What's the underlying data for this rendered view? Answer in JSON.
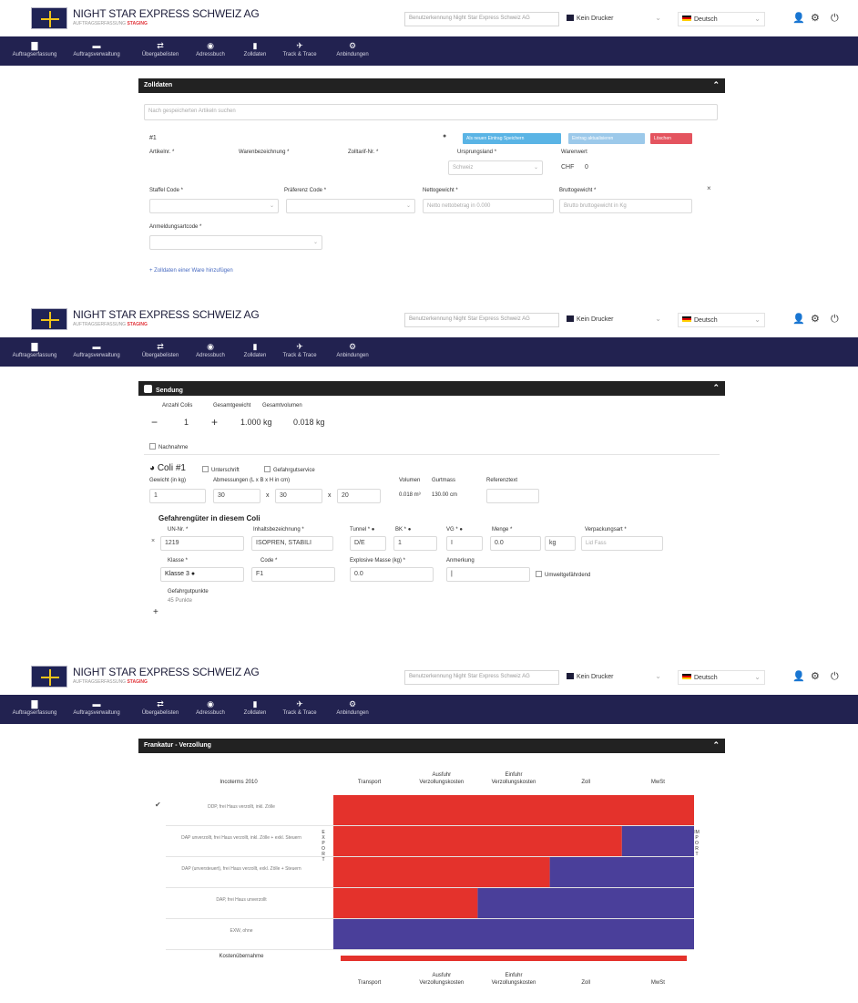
{
  "header": {
    "brand": "NIGHT STAR EXPRESS SCHWEIZ AG",
    "sub_prefix": "AUFTRAGSERFASSUNG",
    "sub_env": "STAGING",
    "user_select": "Benutzerkennung Night Star Express Schweiz AG",
    "printer": "Kein Drucker",
    "language": "Deutsch"
  },
  "nav": [
    {
      "label": "Auftragserfassung",
      "icon": "file-icon"
    },
    {
      "label": "Auftragsverwaltung",
      "icon": "folder-icon"
    },
    {
      "label": "Übergabelisten",
      "icon": "exchange-icon"
    },
    {
      "label": "Adressbuch",
      "icon": "address-book-icon"
    },
    {
      "label": "Zolldaten",
      "icon": "document-icon"
    },
    {
      "label": "Track & Trace",
      "icon": "track-icon"
    },
    {
      "label": "Anbindungen",
      "icon": "cogs-icon"
    }
  ],
  "zolldaten": {
    "title": "Zolldaten",
    "search_placeholder": "Nach gespeicherten Artikeln suchen",
    "position": "#1",
    "btn_save_catalog": "Als neuen Eintrag Speichern",
    "btn_update_catalog": "Eintrag aktualisieren",
    "btn_delete": "Löschen",
    "label_article_no": "Artikelnr. *",
    "label_goods_description": "Warenbezeichnung *",
    "label_tariff_no": "Zolltarif-Nr. *",
    "label_origin_country": "Ursprungsland *",
    "origin_country_value": "Schweiz",
    "label_goods_value": "Warenwert",
    "goods_value_currency": "CHF",
    "goods_value_amount": "0",
    "label_treaty_code": "Staffel Code *",
    "label_preference_code": "Präferenz Code *",
    "label_net_weight": "Nettogewicht *",
    "net_weight_placeholder": "Netto nettobetrag in 0.000",
    "label_gross_weight": "Bruttogewicht *",
    "gross_weight_placeholder": "Brutto bruttogewicht in Kg",
    "label_declaration_code": "Anmeldungsartcode *",
    "add_link": "+ Zolldaten einer Ware hinzufügen"
  },
  "sendung": {
    "title": "Sendung",
    "label_count": "Anzahl Colis",
    "label_total_weight": "Gesamtgewicht",
    "label_total_volume": "Gesamtvolumen",
    "count_value": "1",
    "total_weight": "1.000 kg",
    "total_volume": "0.018 kg",
    "nachnahme": "Nachnahme",
    "coli_title": "Coli #1",
    "coli_check_unterschrift": "Unterschrift",
    "coli_check_gefahrgut": "Gefahrgutservice",
    "label_weight": "Gewicht (in kg)",
    "label_dimensions": "Abmessungen (L x B x H in cm)",
    "label_volume": "Volumen",
    "label_girth": "Gurtmass",
    "label_reference": "Referenztext",
    "weight_value": "1",
    "dim_l": "30",
    "dim_b": "30",
    "dim_h": "20",
    "times": "x",
    "volume_value": "0.018 m³",
    "girth_value": "130.00 cm",
    "dg_title": "Gefahrengüter in diesem Coli",
    "label_un": "UN-Nr. *",
    "label_inhalt": "Inhaltsbezeichnung *",
    "label_tunnel": "Tunnel *",
    "label_bk": "BK *",
    "label_vg": "VG *",
    "label_menge": "Menge *",
    "label_packaging": "Verpackungsart *",
    "un_value": "1219",
    "inhalt_value": "ISOPREN, STABILI",
    "tunnel_value": "D/E",
    "bk_value": "1",
    "vg_value": "I",
    "menge_value": "0.0",
    "unit_value": "kg",
    "packaging_placeholder": "Lid Fass",
    "label_klasse": "Klasse *",
    "klasse_value": "Klasse 3",
    "label_code": "Code *",
    "code_value": "F1",
    "label_explosive": "Explosive Masse (kg) *",
    "explosive_value": "0.0",
    "label_remark": "Anmerkung",
    "remark_value": "|",
    "env_label": "Umweltgefährdend",
    "label_dg_points": "Gefahrgutpunkte",
    "dg_points_value": "45 Punkte",
    "add_plus": "+"
  },
  "frankatur": {
    "title": "Frankatur - Verzollung",
    "incoterms_header": "Incoterms 2010",
    "columns": [
      "Transport",
      "Ausfuhr Verzollungskosten",
      "Einfuhr Verzollungskosten",
      "Zoll",
      "MwSt"
    ],
    "export_letters": "EXPORT",
    "import_letters": "IMPORT",
    "check_mark": "✔",
    "kosten_label": "Kostenübernahme"
  },
  "chart_data": {
    "type": "bar",
    "stacked": true,
    "orientation": "horizontal",
    "categories": [
      "DDP, frei Haus verzollt, inkl. Zölle",
      "DAP unverzollt, frei Haus verzollt, inkl. Zölle + exkl. Steuern",
      "DAP (unversteuert), frei Haus verzollt, exkl. Zölle + Steuern",
      "DAP, frei Haus unverzollt",
      "EXW, ohne"
    ],
    "x_categories": [
      "Transport",
      "Ausfuhr Verzollungskosten",
      "Einfuhr Verzollungskosten",
      "Zoll",
      "MwSt"
    ],
    "series": [
      {
        "name": "Export",
        "color": "#e4322c",
        "values": [
          5,
          4,
          3,
          2,
          0
        ]
      },
      {
        "name": "Import",
        "color": "#4a3f9a",
        "values": [
          0,
          1,
          2,
          3,
          5
        ]
      }
    ],
    "selected_index": 0
  },
  "colors": {
    "nav_bg": "#222250",
    "export_red": "#e4322c",
    "import_blue": "#4a3f9a",
    "btn_blue": "#5ab4e5",
    "btn_light_blue": "#9cc9ea",
    "btn_red": "#e4545f"
  }
}
